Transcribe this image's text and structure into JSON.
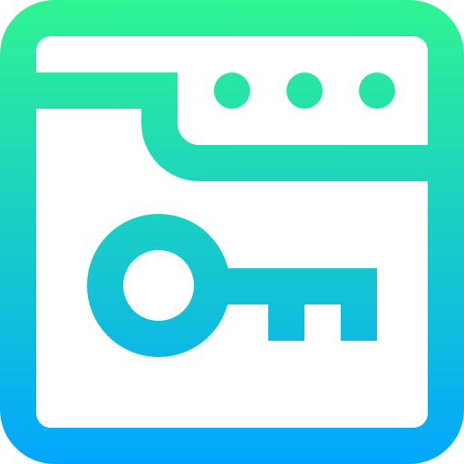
{
  "icon": {
    "name": "browser-key-icon",
    "gradient": {
      "top_color": "#2ff492",
      "bottom_color": "#03a6fd"
    },
    "background_color": "#ffffff",
    "window_controls": [
      "dot",
      "dot",
      "dot"
    ]
  }
}
